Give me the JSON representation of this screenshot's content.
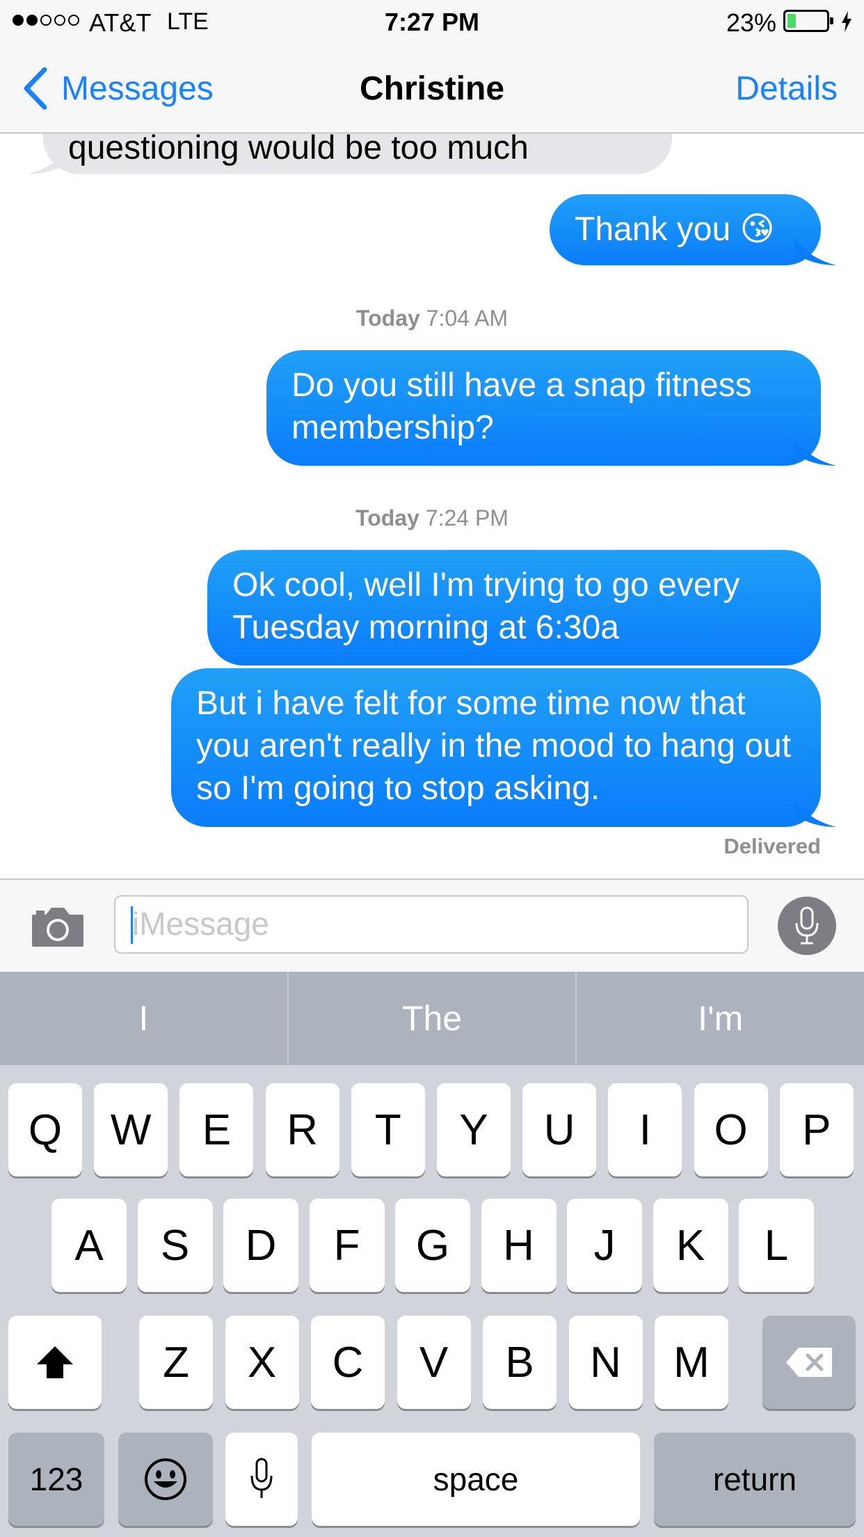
{
  "status_bar": {
    "signal_full": 2,
    "signal_total": 5,
    "carrier": "AT&T",
    "network": "LTE",
    "time": "7:27 PM",
    "battery_percent": "23%",
    "battery_level": 0.23
  },
  "nav": {
    "back_label": "Messages",
    "title": "Christine",
    "details_label": "Details"
  },
  "messages": [
    {
      "type": "bubble",
      "direction": "in",
      "text": "questioning would be too much"
    },
    {
      "type": "bubble",
      "direction": "out",
      "text": "Thank you 😘"
    },
    {
      "type": "timestamp",
      "day": "Today",
      "time": "7:04 AM"
    },
    {
      "type": "bubble",
      "direction": "out",
      "text": "Do you still have a snap fitness membership?"
    },
    {
      "type": "timestamp",
      "day": "Today",
      "time": "7:24 PM"
    },
    {
      "type": "bubble",
      "direction": "out",
      "text": "Ok cool, well I'm trying to go every Tuesday morning at 6:30a"
    },
    {
      "type": "bubble",
      "direction": "out",
      "text": "But i have felt for some time now that you aren't really in the mood to hang out so I'm going to stop asking."
    }
  ],
  "delivery_status": "Delivered",
  "input": {
    "placeholder": "iMessage"
  },
  "keyboard": {
    "suggestions": [
      "I",
      "The",
      "I'm"
    ],
    "row1": [
      "Q",
      "W",
      "E",
      "R",
      "T",
      "Y",
      "U",
      "I",
      "O",
      "P"
    ],
    "row2": [
      "A",
      "S",
      "D",
      "F",
      "G",
      "H",
      "J",
      "K",
      "L"
    ],
    "row3": [
      "Z",
      "X",
      "C",
      "V",
      "B",
      "N",
      "M"
    ],
    "numbers_label": "123",
    "space_label": "space",
    "return_label": "return"
  },
  "icons": {
    "back": "chevron-left-icon",
    "camera": "camera-icon",
    "mic": "microphone-icon",
    "shift": "shift-arrow-icon",
    "delete": "backspace-icon",
    "emoji": "smiley-face-icon",
    "dictation": "microphone-icon",
    "charging": "lightning-bolt-icon"
  },
  "colors": {
    "accent": "#1a82fb",
    "outgoing_bubble": "#1a8cf8",
    "incoming_bubble": "#e5e5ea",
    "battery_fill": "#4cd964",
    "keyboard_bg": "#d1d5db"
  }
}
